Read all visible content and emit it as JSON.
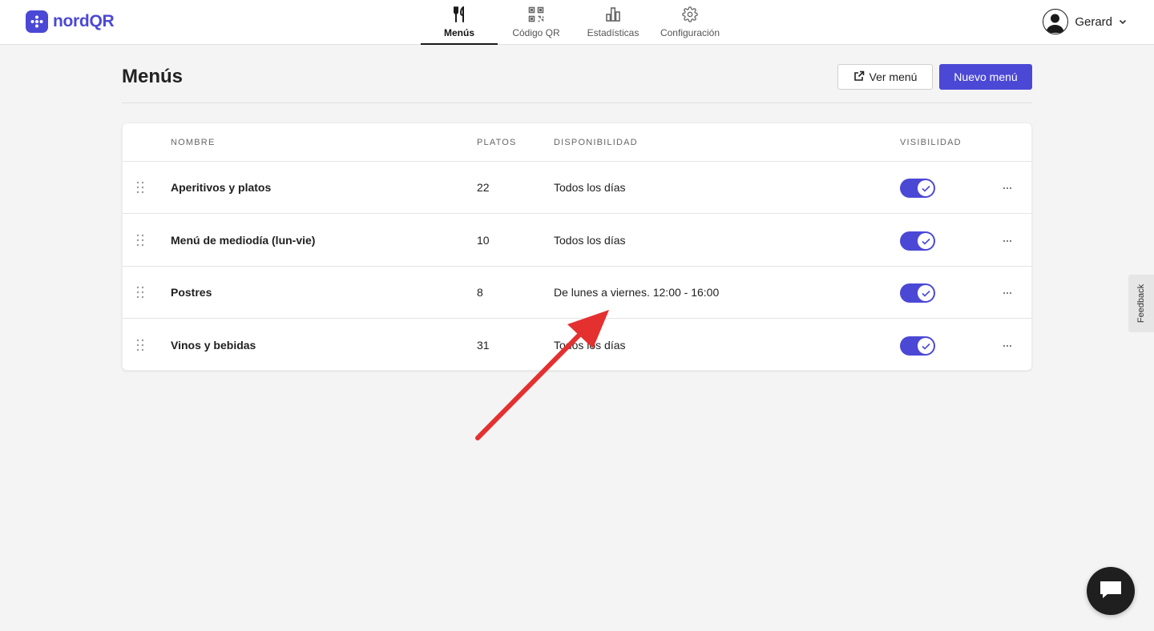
{
  "brand": {
    "name": "nordQR",
    "accent": "#4b48d6"
  },
  "nav": {
    "items": [
      {
        "label": "Menús",
        "icon": "utensils-icon",
        "active": true
      },
      {
        "label": "Código QR",
        "icon": "qr-code-icon",
        "active": false
      },
      {
        "label": "Estadísticas",
        "icon": "bar-chart-icon",
        "active": false
      },
      {
        "label": "Configuración",
        "icon": "gear-icon",
        "active": false
      }
    ]
  },
  "user": {
    "name": "Gerard"
  },
  "header": {
    "title": "Menús",
    "view_button": "Ver menú",
    "new_button": "Nuevo menú"
  },
  "table": {
    "columns": [
      "NOMBRE",
      "PLATOS",
      "DISPONIBILIDAD",
      "VISIBILIDAD"
    ],
    "rows": [
      {
        "name": "Aperitivos y platos",
        "platos": "22",
        "disponibilidad": "Todos los días",
        "visible": true
      },
      {
        "name": "Menú de mediodía (lun-vie)",
        "platos": "10",
        "disponibilidad": "Todos los días",
        "visible": true
      },
      {
        "name": "Postres",
        "platos": "8",
        "disponibilidad": "De lunes a viernes. 12:00 - 16:00",
        "visible": true
      },
      {
        "name": "Vinos y bebidas",
        "platos": "31",
        "disponibilidad": "Todos los días",
        "visible": true
      }
    ]
  },
  "feedback": {
    "label": "Feedback"
  },
  "annotation": {
    "arrow_color": "#e53030"
  }
}
